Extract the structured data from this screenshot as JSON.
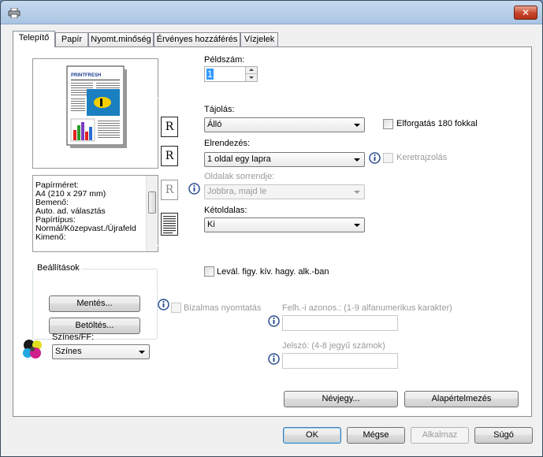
{
  "window": {
    "close_glyph": "✕"
  },
  "tabs": [
    {
      "label": "Telepítő"
    },
    {
      "label": "Papír"
    },
    {
      "label": "Nyomt.minőség"
    },
    {
      "label": "Érvényes hozzáférés"
    },
    {
      "label": "Vízjelek"
    }
  ],
  "preview": {
    "brand_text": "PRINTFRESH"
  },
  "summary": {
    "lines": [
      "Papírméret:",
      "  A4 (210 x 297 mm)",
      "Bemenő:",
      "  Auto. ad. választás",
      "Papírtípus:",
      "  Normál/Közepvast./Újrafeld",
      "Kimenő:"
    ]
  },
  "copies": {
    "label": "Példszám:",
    "value": "1"
  },
  "orientation": {
    "label": "Tájolás:",
    "value": "Álló",
    "rotate_label": "Elforgatás 180 fokkal",
    "glyph": "R"
  },
  "layout": {
    "label": "Elrendezés:",
    "value": "1 oldal egy lapra",
    "border_label": "Keretrajzolás",
    "glyph": "R"
  },
  "page_order": {
    "label": "Oldalak sorrendje:",
    "value": "Jobbra, majd le",
    "glyph": "R"
  },
  "duplex": {
    "label": "Kétoldalas:",
    "value": "Ki"
  },
  "settings_group": {
    "label": "Beállítások",
    "save": "Mentés...",
    "load": "Betöltés..."
  },
  "color": {
    "label": "Színes/FF:",
    "value": "Színes"
  },
  "envelope": {
    "label": "Levál. figy. kív. hagy. alk.-ban"
  },
  "confidential": {
    "label": "Bizalmas nyomtatás",
    "user_label": "Felh.-i azonos.: (1-9 alfanumerikus karakter)",
    "password_label": "Jelszó: (4-8 jegyű számok)"
  },
  "panel_buttons": {
    "about": "Névjegy...",
    "defaults": "Alapértelmezés"
  },
  "dialog_buttons": {
    "ok": "OK",
    "cancel": "Mégse",
    "apply": "Alkalmaz",
    "help": "Súgó"
  }
}
